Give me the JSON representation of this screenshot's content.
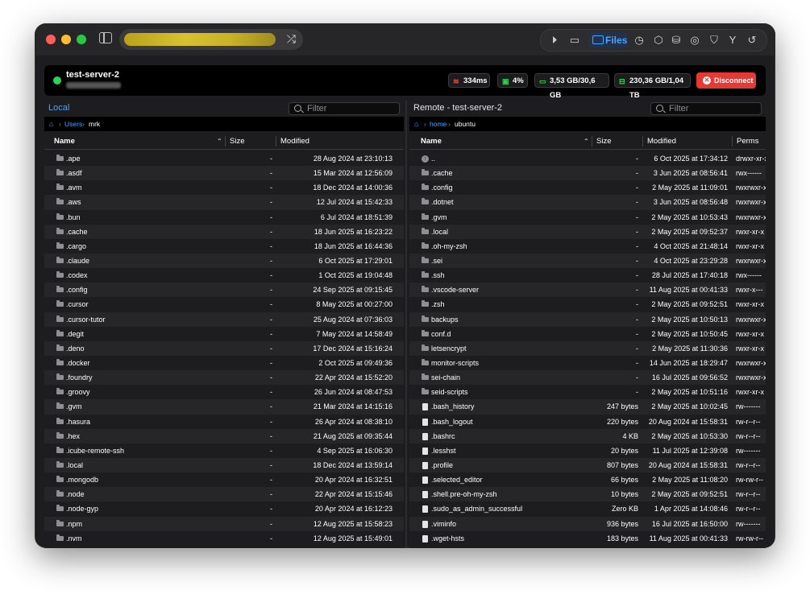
{
  "toolbar": {
    "files_label": "Files",
    "icons": [
      "play-circle-icon",
      "terminal-icon",
      "folder-icon",
      "clock-icon",
      "cube-icon",
      "database-icon",
      "globe-icon",
      "shield-icon",
      "fork-icon",
      "history-icon"
    ]
  },
  "server": {
    "name": "test-server-2",
    "status_color": "#30d158",
    "latency": "334ms",
    "cpu": "4%",
    "memory": "3,53 GB/30,6 GB",
    "disk": "230,36 GB/1,04 TB",
    "disconnect_label": "Disconnect"
  },
  "local": {
    "title": "Local",
    "filter_placeholder": "Filter",
    "breadcrumb": [
      "Users",
      "mrk"
    ],
    "columns": {
      "name": "Name",
      "size": "Size",
      "modified": "Modified"
    },
    "rows": [
      {
        "name": ".ape",
        "size": "-",
        "modified": "28 Aug 2024 at 23:10:13"
      },
      {
        "name": ".asdf",
        "size": "-",
        "modified": "15 Mar 2024 at 12:56:09"
      },
      {
        "name": ".avm",
        "size": "-",
        "modified": "18 Dec 2024 at 14:00:36"
      },
      {
        "name": ".aws",
        "size": "-",
        "modified": "12 Jul 2024 at 15:42:33"
      },
      {
        "name": ".bun",
        "size": "-",
        "modified": "6 Jul 2024 at 18:51:39"
      },
      {
        "name": ".cache",
        "size": "-",
        "modified": "18 Jun 2025 at 16:23:22"
      },
      {
        "name": ".cargo",
        "size": "-",
        "modified": "18 Jun 2025 at 16:44:36"
      },
      {
        "name": ".claude",
        "size": "-",
        "modified": "6 Oct 2025 at 17:29:01"
      },
      {
        "name": ".codex",
        "size": "-",
        "modified": "1 Oct 2025 at 19:04:48"
      },
      {
        "name": ".config",
        "size": "-",
        "modified": "24 Sep 2025 at 09:15:45"
      },
      {
        "name": ".cursor",
        "size": "-",
        "modified": "8 May 2025 at 00:27:00"
      },
      {
        "name": ".cursor-tutor",
        "size": "-",
        "modified": "25 Aug 2024 at 07:36:03"
      },
      {
        "name": ".degit",
        "size": "-",
        "modified": "7 May 2024 at 14:58:49"
      },
      {
        "name": ".deno",
        "size": "-",
        "modified": "17 Dec 2024 at 15:16:24"
      },
      {
        "name": ".docker",
        "size": "-",
        "modified": "2 Oct 2025 at 09:49:36"
      },
      {
        "name": ".foundry",
        "size": "-",
        "modified": "22 Apr 2024 at 15:52:20"
      },
      {
        "name": ".groovy",
        "size": "-",
        "modified": "26 Jun 2024 at 08:47:53"
      },
      {
        "name": ".gvm",
        "size": "-",
        "modified": "21 Mar 2024 at 14:15:16"
      },
      {
        "name": ".hasura",
        "size": "-",
        "modified": "26 Apr 2024 at 08:38:10"
      },
      {
        "name": ".hex",
        "size": "-",
        "modified": "21 Aug 2025 at 09:35:44"
      },
      {
        "name": ".icube-remote-ssh",
        "size": "-",
        "modified": "4 Sep 2025 at 16:06:30"
      },
      {
        "name": ".local",
        "size": "-",
        "modified": "18 Dec 2024 at 13:59:14"
      },
      {
        "name": ".mongodb",
        "size": "-",
        "modified": "20 Apr 2024 at 16:32:51"
      },
      {
        "name": ".node",
        "size": "-",
        "modified": "22 Apr 2024 at 15:15:46"
      },
      {
        "name": ".node-gyp",
        "size": "-",
        "modified": "20 Apr 2024 at 16:12:23"
      },
      {
        "name": ".npm",
        "size": "-",
        "modified": "12 Aug 2025 at 15:58:23"
      },
      {
        "name": ".nvm",
        "size": "-",
        "modified": "12 Aug 2025 at 15:49:01"
      }
    ]
  },
  "remote": {
    "title": "Remote - test-server-2",
    "filter_placeholder": "Filter",
    "breadcrumb": [
      "home",
      "ubuntu"
    ],
    "columns": {
      "name": "Name",
      "size": "Size",
      "modified": "Modified",
      "perms": "Perms"
    },
    "rows": [
      {
        "type": "up",
        "name": "..",
        "size": "-",
        "modified": "6 Oct 2025 at 17:34:12",
        "perms": "drwxr-xr-x"
      },
      {
        "type": "folder",
        "name": ".cache",
        "size": "-",
        "modified": "3 Jun 2025 at 08:56:41",
        "perms": "rwx------"
      },
      {
        "type": "folder",
        "name": ".config",
        "size": "-",
        "modified": "2 May 2025 at 11:09:01",
        "perms": "rwxrwxr-x"
      },
      {
        "type": "folder",
        "name": ".dotnet",
        "size": "-",
        "modified": "3 Jun 2025 at 08:56:48",
        "perms": "rwxrwxr-x"
      },
      {
        "type": "folder",
        "name": ".gvm",
        "size": "-",
        "modified": "2 May 2025 at 10:53:43",
        "perms": "rwxrwxr-x"
      },
      {
        "type": "folder",
        "name": ".local",
        "size": "-",
        "modified": "2 May 2025 at 09:52:37",
        "perms": "rwxr-xr-x"
      },
      {
        "type": "folder",
        "name": ".oh-my-zsh",
        "size": "-",
        "modified": "4 Oct 2025 at 21:48:14",
        "perms": "rwxr-xr-x"
      },
      {
        "type": "folder",
        "name": ".sei",
        "size": "-",
        "modified": "4 Oct 2025 at 23:29:28",
        "perms": "rwxrwxr-x"
      },
      {
        "type": "folder",
        "name": ".ssh",
        "size": "-",
        "modified": "28 Jul 2025 at 17:40:18",
        "perms": "rwx------"
      },
      {
        "type": "folder",
        "name": ".vscode-server",
        "size": "-",
        "modified": "11 Aug 2025 at 00:41:33",
        "perms": "rwxr-x---"
      },
      {
        "type": "folder",
        "name": ".zsh",
        "size": "-",
        "modified": "2 May 2025 at 09:52:51",
        "perms": "rwxr-xr-x"
      },
      {
        "type": "folder",
        "name": "backups",
        "size": "-",
        "modified": "2 May 2025 at 10:50:13",
        "perms": "rwxrwxr-x"
      },
      {
        "type": "folder",
        "name": "conf.d",
        "size": "-",
        "modified": "2 May 2025 at 10:50:45",
        "perms": "rwxr-xr-x"
      },
      {
        "type": "folder",
        "name": "letsencrypt",
        "size": "-",
        "modified": "2 May 2025 at 11:30:36",
        "perms": "rwxr-xr-x"
      },
      {
        "type": "folder",
        "name": "monitor-scripts",
        "size": "-",
        "modified": "14 Jun 2025 at 18:29:47",
        "perms": "rwxrwxr-x"
      },
      {
        "type": "folder",
        "name": "sei-chain",
        "size": "-",
        "modified": "16 Jul 2025 at 09:56:52",
        "perms": "rwxrwxr-x"
      },
      {
        "type": "folder",
        "name": "seid-scripts",
        "size": "-",
        "modified": "2 May 2025 at 10:51:16",
        "perms": "rwxr-xr-x"
      },
      {
        "type": "file",
        "name": ".bash_history",
        "size": "247 bytes",
        "modified": "2 May 2025 at 10:02:45",
        "perms": "rw-------"
      },
      {
        "type": "file",
        "name": ".bash_logout",
        "size": "220 bytes",
        "modified": "20 Aug 2024 at 15:58:31",
        "perms": "rw-r--r--"
      },
      {
        "type": "file",
        "name": ".bashrc",
        "size": "4 KB",
        "modified": "2 May 2025 at 10:53:30",
        "perms": "rw-r--r--"
      },
      {
        "type": "file",
        "name": ".lesshst",
        "size": "20 bytes",
        "modified": "11 Jul 2025 at 12:39:08",
        "perms": "rw-------"
      },
      {
        "type": "file",
        "name": ".profile",
        "size": "807 bytes",
        "modified": "20 Aug 2024 at 15:58:31",
        "perms": "rw-r--r--"
      },
      {
        "type": "file",
        "name": ".selected_editor",
        "size": "66 bytes",
        "modified": "2 May 2025 at 11:08:20",
        "perms": "rw-rw-r--"
      },
      {
        "type": "file",
        "name": ".shell.pre-oh-my-zsh",
        "size": "10 bytes",
        "modified": "2 May 2025 at 09:52:51",
        "perms": "rw-r--r--"
      },
      {
        "type": "file",
        "name": ".sudo_as_admin_successful",
        "size": "Zero KB",
        "modified": "1 Apr 2025 at 14:08:46",
        "perms": "rw-r--r--"
      },
      {
        "type": "file",
        "name": ".viminfo",
        "size": "936 bytes",
        "modified": "16 Jul 2025 at 16:50:00",
        "perms": "rw-------"
      },
      {
        "type": "file",
        "name": ".wget-hsts",
        "size": "183 bytes",
        "modified": "11 Aug 2025 at 00:41:33",
        "perms": "rw-rw-r--"
      }
    ]
  }
}
